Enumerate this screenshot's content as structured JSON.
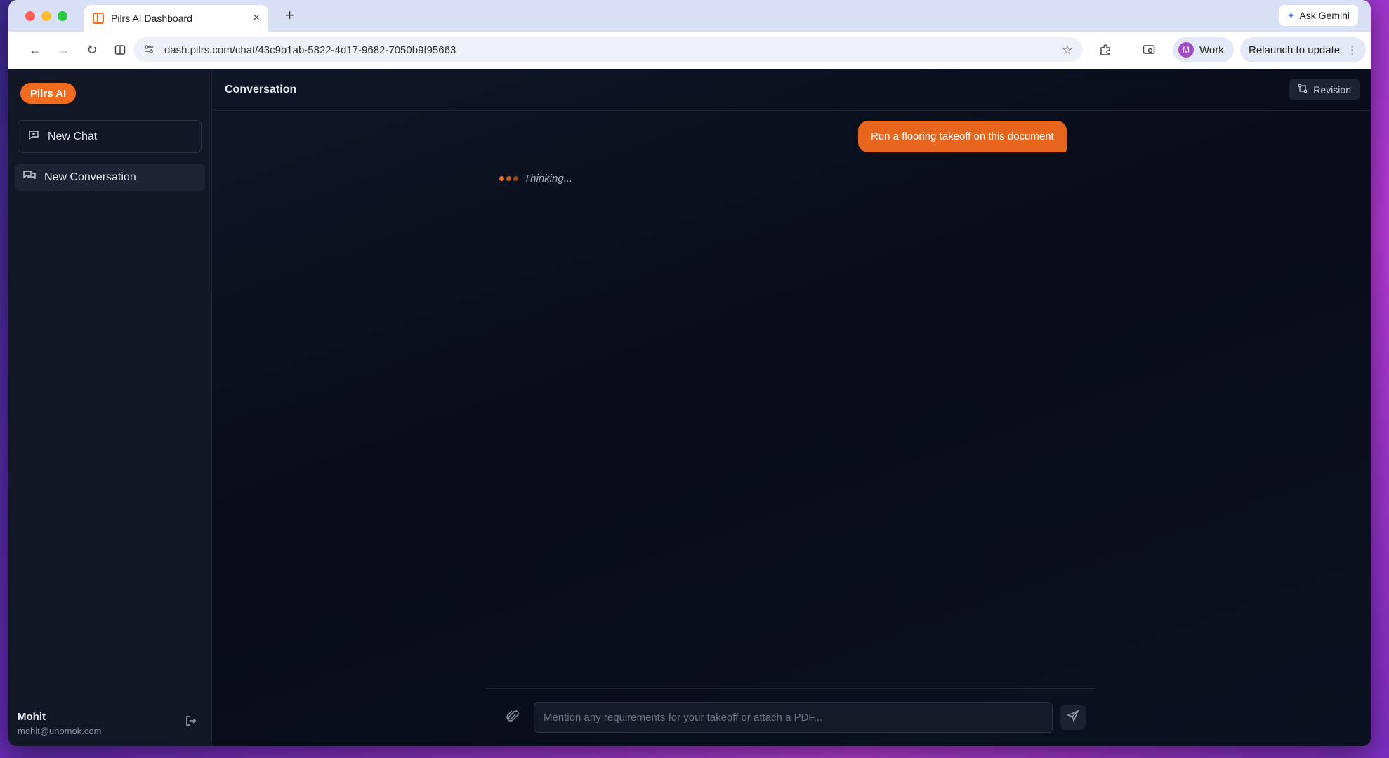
{
  "browser": {
    "tab_title": "Pilrs AI Dashboard",
    "new_tab_glyph": "+",
    "close_glyph": "×",
    "ask_gemini_label": "Ask Gemini",
    "url": "dash.pilrs.com/chat/43c9b1ab-5822-4d17-9682-7050b9f95663",
    "profile_initial": "M",
    "profile_label": "Work",
    "relaunch_label": "Relaunch to update",
    "menu_glyph": "⋮"
  },
  "sidebar": {
    "brand": "Pilrs AI",
    "new_chat_label": "New Chat",
    "conversations": [
      {
        "label": "New Conversation"
      }
    ],
    "user": {
      "name": "Mohit",
      "email": "mohit@unomok.com"
    }
  },
  "main": {
    "title": "Conversation",
    "revision_label": "Revision",
    "messages": [
      {
        "role": "user",
        "text": "Run a flooring takeoff on this document"
      }
    ],
    "status_text": "Thinking...",
    "composer": {
      "placeholder": "Mention any requirements for your takeoff or attach a PDF...",
      "value": ""
    }
  },
  "colors": {
    "accent": "#f26b1f",
    "sidebar_bg": "#111725",
    "main_bg": "#080c18"
  }
}
